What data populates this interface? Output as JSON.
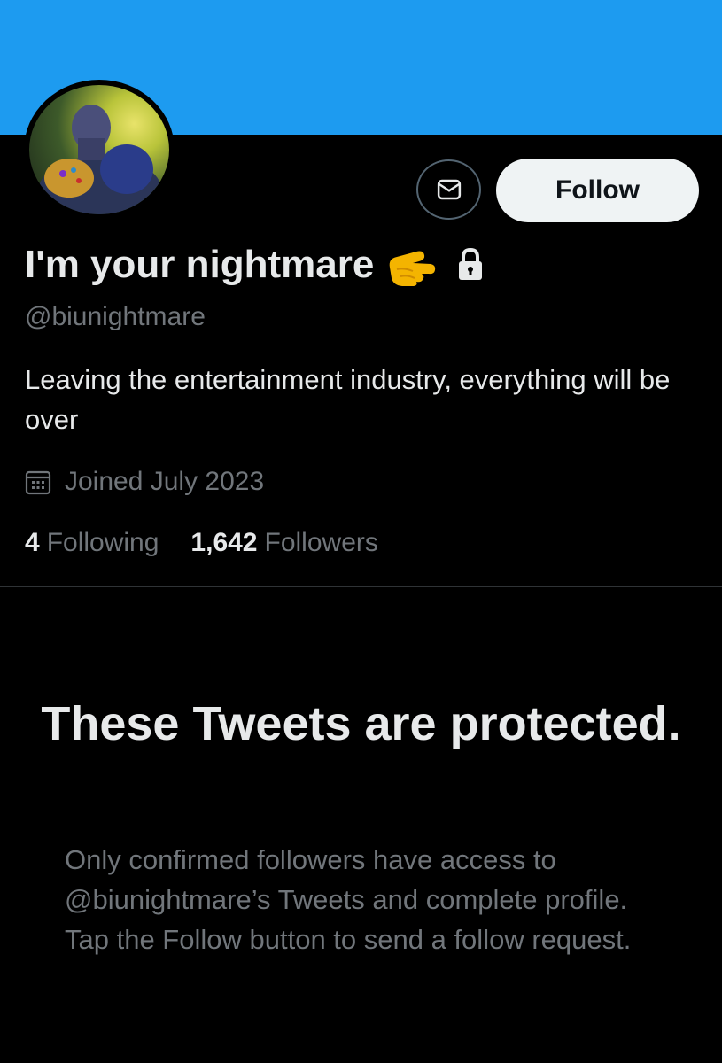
{
  "profile": {
    "display_name": "I'm your nightmare",
    "handle": "@biunightmare",
    "bio": "Leaving the entertainment industry, everything will be over",
    "joined": "Joined July 2023",
    "following_count": "4",
    "following_label": "Following",
    "followers_count": "1,642",
    "followers_label": "Followers",
    "name_emoji": "pointing-hand-emoji",
    "protected_icon": "lock-icon"
  },
  "actions": {
    "follow_label": "Follow",
    "message_icon": "mail-icon"
  },
  "protected": {
    "title": "These Tweets are protected.",
    "body": "Only confirmed followers have access to @biunightmare’s Tweets and complete profile. Tap the Follow button to send a follow request."
  },
  "colors": {
    "banner": "#1d9bf0",
    "background": "#000000",
    "primary_text": "#e7e9ea",
    "secondary_text": "#71767b",
    "follow_button_bg": "#eff3f4"
  }
}
